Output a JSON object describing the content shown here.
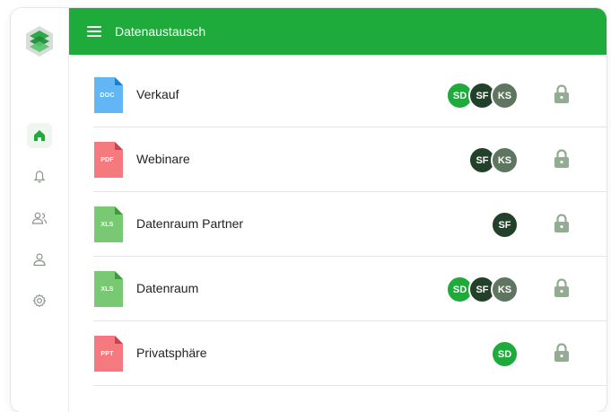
{
  "header": {
    "title": "Datenaustausch",
    "background": "#1faa3c"
  },
  "sidebar": {
    "items": [
      {
        "icon": "home-icon",
        "active": true
      },
      {
        "icon": "bell-icon",
        "active": false
      },
      {
        "icon": "users-icon",
        "active": false
      },
      {
        "icon": "user-icon",
        "active": false
      },
      {
        "icon": "gear-icon",
        "active": false
      }
    ]
  },
  "colors": {
    "sd": "#1faa3c",
    "sf": "#23402a",
    "ks": "#5e7660",
    "lock": "#93ab93"
  },
  "files": [
    {
      "name": "Verkauf",
      "type": "DOC",
      "color": "#62b6f4",
      "fold": "#1e7fc8",
      "members": [
        "SD",
        "SF",
        "KS"
      ]
    },
    {
      "name": "Webinare",
      "type": "PDF",
      "color": "#f57a80",
      "fold": "#c84450",
      "members": [
        "SF",
        "KS"
      ]
    },
    {
      "name": "Datenraum Partner",
      "type": "XLS",
      "color": "#79c873",
      "fold": "#3f9a3a",
      "members": [
        "SF"
      ]
    },
    {
      "name": "Datenraum",
      "type": "XLS",
      "color": "#79c873",
      "fold": "#3f9a3a",
      "members": [
        "SD",
        "SF",
        "KS"
      ]
    },
    {
      "name": "Privatsphäre",
      "type": "PPT",
      "color": "#f57a80",
      "fold": "#c84450",
      "members": [
        "SD"
      ]
    }
  ]
}
